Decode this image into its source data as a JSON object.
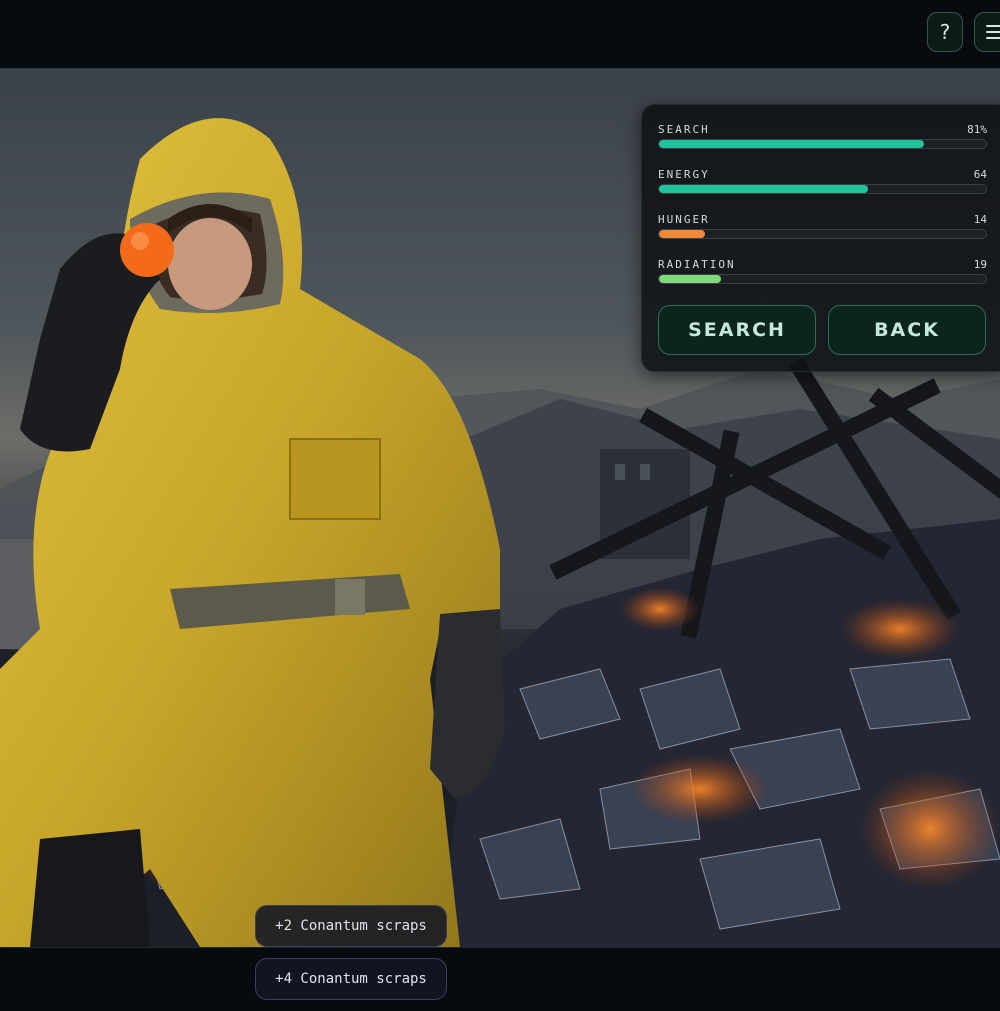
{
  "header": {
    "help_label": "?",
    "help_icon": "question-icon",
    "menu_icon": "hamburger-menu-icon"
  },
  "status_panel": {
    "stats": [
      {
        "label": "SEARCH",
        "value": "81%",
        "level": 81,
        "color": "#1fc49a"
      },
      {
        "label": "ENERGY",
        "value": "64",
        "level": 64,
        "color": "#1fc49a"
      },
      {
        "label": "HUNGER",
        "value": "14",
        "level": 14,
        "color": "#f0883a"
      },
      {
        "label": "RADIATION",
        "value": "19",
        "level": 19,
        "color": "#7fd87a"
      }
    ],
    "search_button": "SEARCH",
    "back_button": "BACK"
  },
  "notifications": [
    {
      "text": "+2 Conantum scraps"
    },
    {
      "text": "+4 Conantum scraps"
    }
  ],
  "colors": {
    "accent": "#1fc49a",
    "background": "#070a0e",
    "button_border": "#2e6e58"
  }
}
